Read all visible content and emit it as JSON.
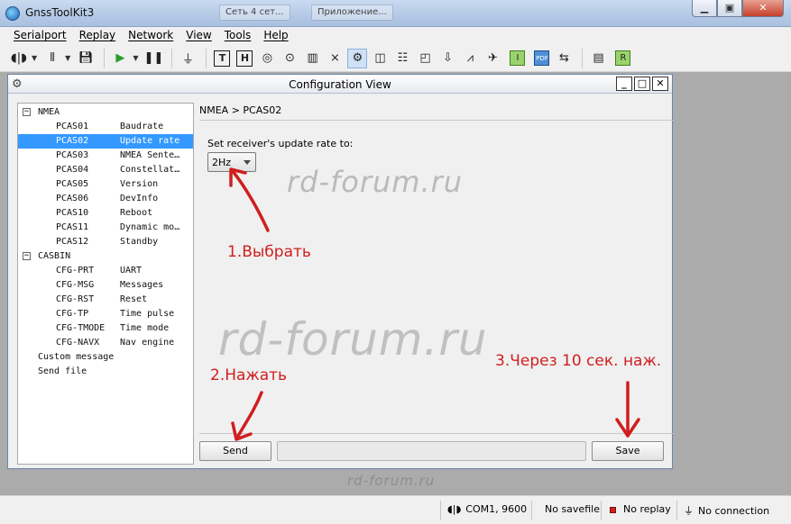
{
  "app": {
    "title": "GnssToolKit3",
    "bg_tab_1": "Сеть 4 сет...",
    "bg_tab_2": "Приложение..."
  },
  "menu": {
    "serialport": "Serialport",
    "replay": "Replay",
    "network": "Network",
    "view": "View",
    "tools": "Tools",
    "help": "Help"
  },
  "toolbar": {
    "icons": [
      "connect-icon",
      "signal-icon",
      "save-icon",
      "play-icon",
      "pause-icon",
      "plug-icon",
      "text-view-icon",
      "hex-view-icon",
      "sky-view-icon",
      "position-icon",
      "chart-icon",
      "satellite-icon",
      "config-icon",
      "map-icon",
      "table-icon",
      "chart-2-icon",
      "download-icon",
      "signal-2-icon",
      "satellite-2-icon",
      "green-icon",
      "pdf-icon",
      "sync-icon",
      "layout-icon",
      "r-icon"
    ],
    "h_label": "H",
    "t_label": "T",
    "r_label": "R",
    "pdf_label": "PDF",
    "green_label": "I"
  },
  "config_window": {
    "title": "Configuration View",
    "breadcrumb": "NMEA > PCAS02",
    "rate_label": "Set receiver's update rate to:",
    "rate_value": "2Hz",
    "send_label": "Send",
    "save_label": "Save"
  },
  "tree": {
    "nmea": {
      "label": "NMEA",
      "items": [
        {
          "name": "PCAS01",
          "desc": "Baudrate"
        },
        {
          "name": "PCAS02",
          "desc": "Update rate"
        },
        {
          "name": "PCAS03",
          "desc": "NMEA Sente…"
        },
        {
          "name": "PCAS04",
          "desc": "Constellat…"
        },
        {
          "name": "PCAS05",
          "desc": "Version"
        },
        {
          "name": "PCAS06",
          "desc": "DevInfo"
        },
        {
          "name": "PCAS10",
          "desc": "Reboot"
        },
        {
          "name": "PCAS11",
          "desc": "Dynamic mo…"
        },
        {
          "name": "PCAS12",
          "desc": "Standby"
        }
      ]
    },
    "casbin": {
      "label": "CASBIN",
      "items": [
        {
          "name": "CFG-PRT",
          "desc": "UART"
        },
        {
          "name": "CFG-MSG",
          "desc": "Messages"
        },
        {
          "name": "CFG-RST",
          "desc": "Reset"
        },
        {
          "name": "CFG-TP",
          "desc": "Time pulse"
        },
        {
          "name": "CFG-TMODE",
          "desc": "Time mode"
        },
        {
          "name": "CFG-NAVX",
          "desc": "Nav engine"
        }
      ]
    },
    "custom_message": "Custom message",
    "send_file": "Send file"
  },
  "annotations": {
    "step1": "1.Выбрать",
    "step2": "2.Нажать",
    "step3": "3.Через 10 сек. наж.",
    "watermark": "rd-forum.ru"
  },
  "status": {
    "port": "COM1, 9600",
    "savefile": "No savefile",
    "replay": "No replay",
    "connection": "No connection"
  },
  "colors": {
    "selection": "#3399ff",
    "annotation_red": "#d01e1e"
  }
}
